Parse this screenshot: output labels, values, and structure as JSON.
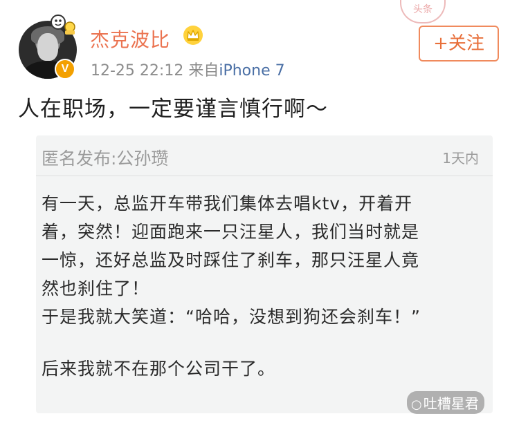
{
  "header": {
    "username": "杰克波比",
    "timestamp": "12-25 22:12",
    "source_prefix": "来自",
    "source_device": "iPhone 7",
    "follow_label": "+关注",
    "verified_badge": "V",
    "stamp_text": "头条"
  },
  "post": {
    "text": "人在职场，一定要谨言慎行啊～"
  },
  "card": {
    "author": "匿名发布:公孙瓒",
    "time": "1天内",
    "lines": [
      "有一天，总监开车带我们集体去唱ktv，开着开",
      "着，突然！迎面跑来一只汪星人，我们当时就是",
      "一惊，还好总监及时踩住了刹车，那只汪星人竟",
      "然也刹住了！",
      "于是我就大笑道：“哈哈，没想到狗还会刹车！”",
      "后来我就不在那个公司干了。"
    ]
  },
  "watermark": {
    "text": "吐槽星君",
    "icon": "wechat-icon"
  },
  "colors": {
    "name": "#eb7350",
    "follow": "#e86f3a",
    "card_bg": "#f3f4f4",
    "badge": "#f3a000"
  }
}
